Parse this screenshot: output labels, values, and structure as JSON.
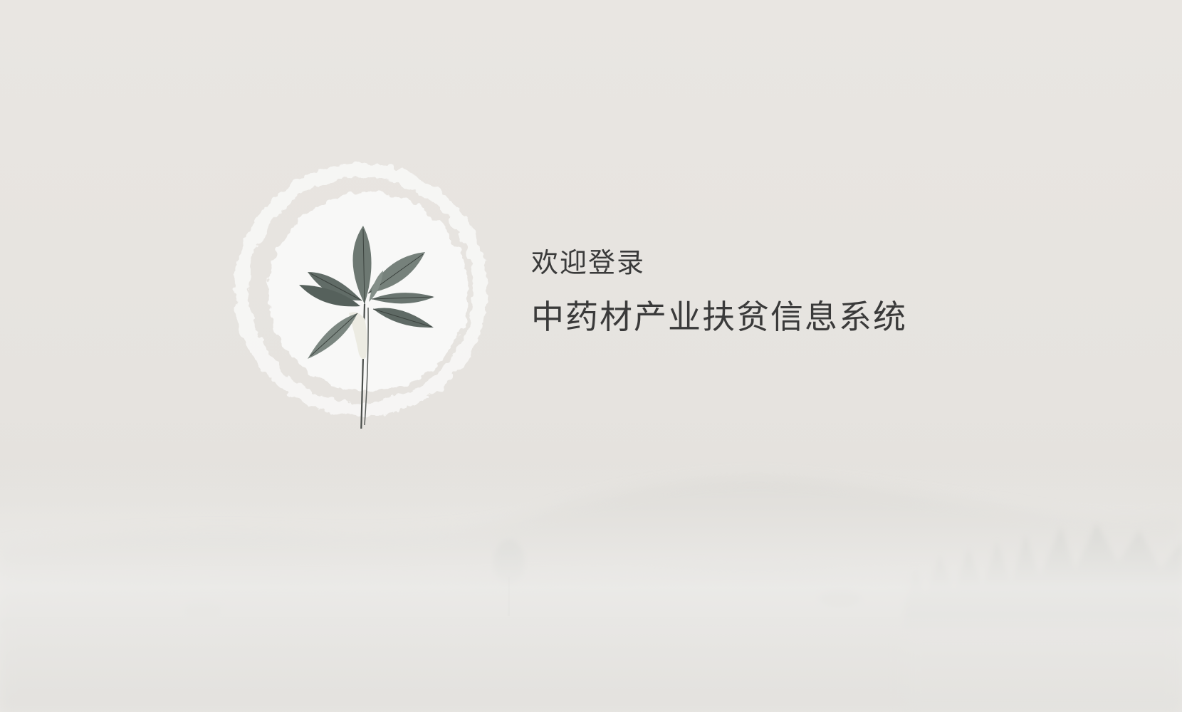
{
  "login": {
    "welcome": "欢迎登录",
    "system_name": "中药材产业扶贫信息系统"
  },
  "colors": {
    "background": "#e8e5e1",
    "text": "#3a3a3a",
    "leaf": "#5e6a63"
  },
  "icons": {
    "emblem": "herb-leaf-ink-circle-icon"
  }
}
